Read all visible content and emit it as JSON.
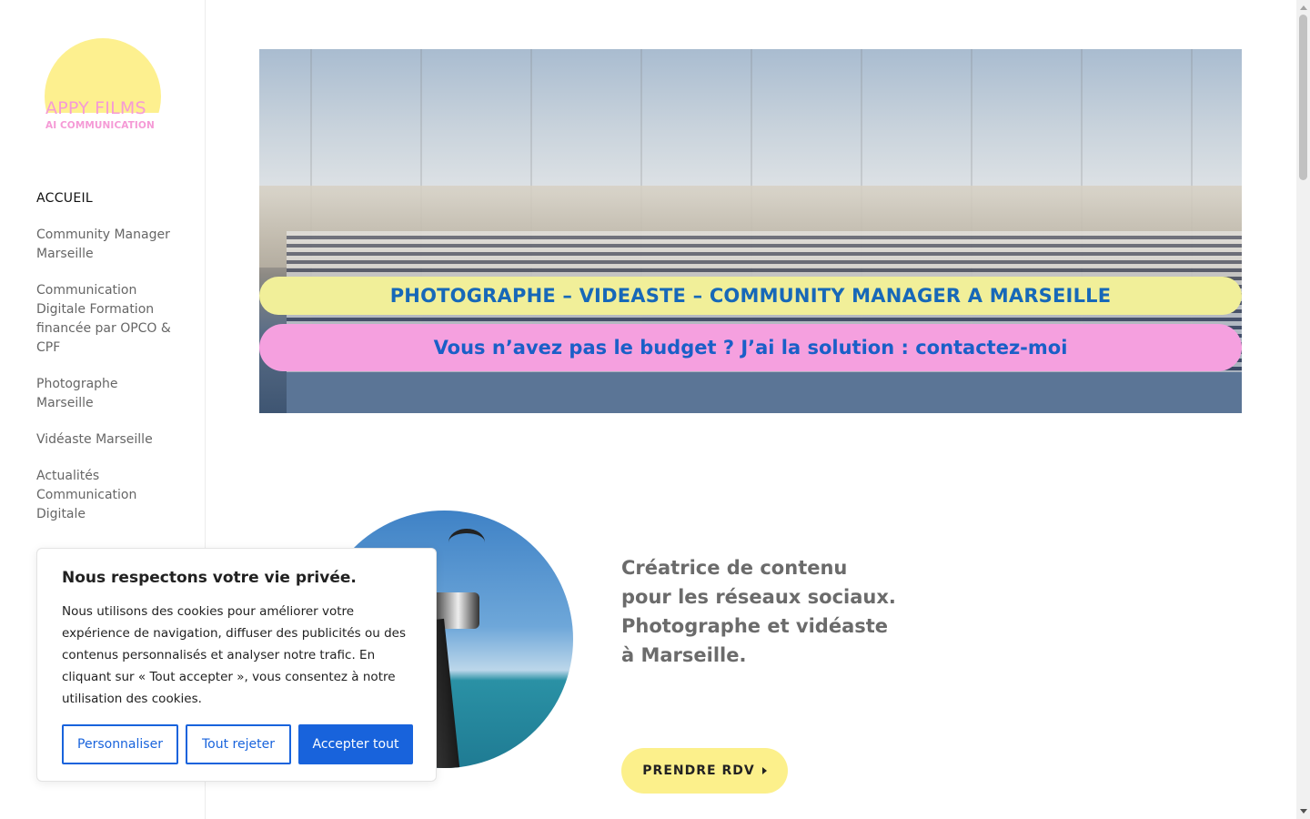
{
  "logo": {
    "line1": "APPY FILMS",
    "line2": "AI COMMUNICATION"
  },
  "nav": [
    {
      "label": "ACCUEIL"
    },
    {
      "label": "Community Manager Marseille"
    },
    {
      "label": "Communication Digitale Formation financée par OPCO & CPF"
    },
    {
      "label": "Photographe Marseille"
    },
    {
      "label": "Vidéaste Marseille"
    },
    {
      "label": "Actualités Communication Digitale"
    }
  ],
  "hero": {
    "headline": "PHOTOGRAPHE – VIDEASTE – COMMUNITY MANAGER A MARSEILLE",
    "subline": "Vous n’avez pas le budget ? J’ai la solution : contactez-moi"
  },
  "intro": {
    "line1": "Créatrice de contenu",
    "line2": "pour les réseaux sociaux.",
    "line3": "Photographe et vidéaste",
    "line4": "à Marseille.",
    "cta": "PRENDRE RDV"
  },
  "cookie": {
    "title": "Nous respectons votre vie privée.",
    "text": "Nous utilisons des cookies pour améliorer votre expérience de navigation, diffuser des publicités ou des contenus personnalisés et analyser notre trafic. En cliquant sur « Tout accepter », vous consentez à notre utilisation des cookies.",
    "customize": "Personnaliser",
    "reject": "Tout rejeter",
    "accept": "Accepter tout"
  },
  "colors": {
    "yellow": "#fcf08b",
    "pink": "#f5a0df",
    "blue": "#1863dc"
  }
}
